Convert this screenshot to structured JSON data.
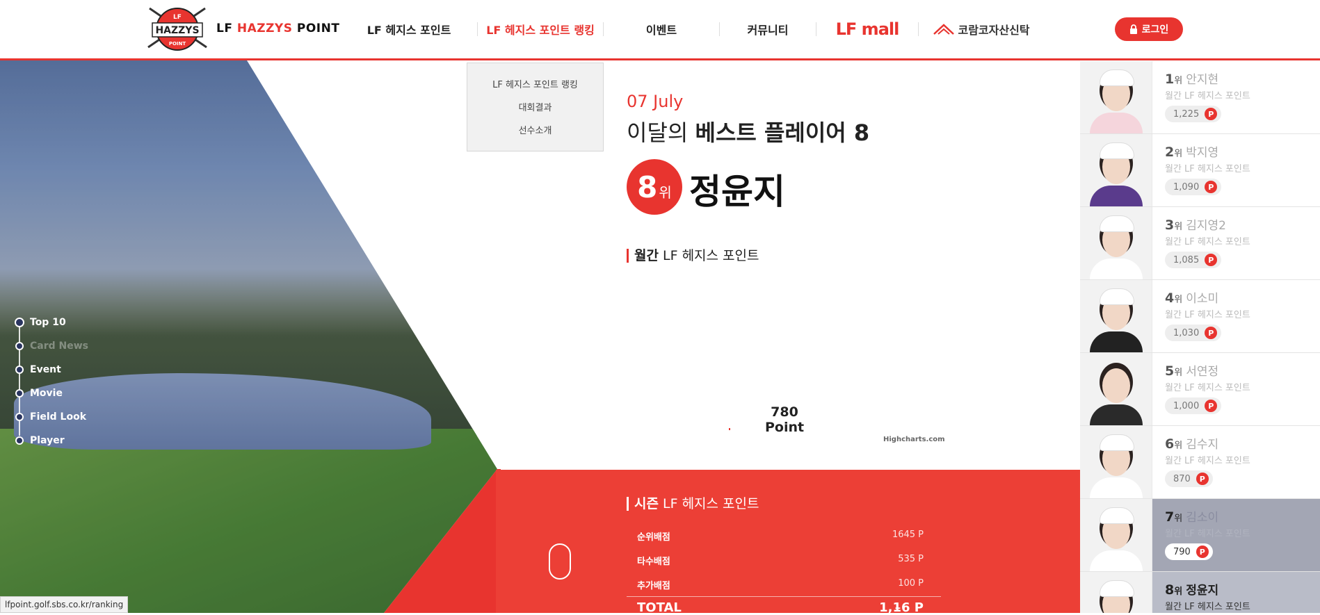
{
  "header": {
    "logo_badge_top": "LF",
    "logo_badge_main": "HAZZYS",
    "logo_badge_bottom": "POINT",
    "logo_prefix": "LF",
    "logo_brand": "HAZZYS",
    "logo_suffix": "POINT",
    "nav": [
      {
        "label": "LF 헤지스 포인트",
        "active": false
      },
      {
        "label": "LF 헤지스 포인트 랭킹",
        "active": true
      },
      {
        "label": "이벤트",
        "active": false
      },
      {
        "label": "커뮤니티",
        "active": false
      }
    ],
    "lfmall": "LF mall",
    "kolon": "코람코자산신탁",
    "login": "로그인"
  },
  "dropdown": [
    "LF 헤지스 포인트 랭킹",
    "대회결과",
    "선수소개"
  ],
  "side_nav": [
    {
      "label": "Top 10",
      "active": true
    },
    {
      "label": "Card News",
      "faded": true
    },
    {
      "label": "Event"
    },
    {
      "label": "Movie"
    },
    {
      "label": "Field Look"
    },
    {
      "label": "Player"
    }
  ],
  "feature": {
    "date": "07 July",
    "headline_prefix": "이달의",
    "headline_bold": "베스트 플레이어 8",
    "rank_number": "8",
    "rank_unit": "위",
    "player": "정윤지",
    "monthly_title_bold": "월간",
    "monthly_title_rest": "LF 헤지스 포인트",
    "chart_value": "780",
    "chart_unit": "Point",
    "credit": "Highcharts.com"
  },
  "season": {
    "title_bold": "시즌",
    "title_rest": "LF 헤지스 포인트",
    "rows": [
      {
        "label": "순위배점",
        "value": "1645 P"
      },
      {
        "label": "타수배점",
        "value": "535 P"
      },
      {
        "label": "추가배점",
        "value": "100 P"
      }
    ],
    "total_label": "TOTAL",
    "total_value": "1,1̵6 P"
  },
  "ranking": [
    {
      "rank": "1",
      "unit": "위",
      "name": "안지현",
      "sub": "월간 LF 헤지스 포인트",
      "points": "1,225"
    },
    {
      "rank": "2",
      "unit": "위",
      "name": "박지영",
      "sub": "월간 LF 헤지스 포인트",
      "points": "1,090"
    },
    {
      "rank": "3",
      "unit": "위",
      "name": "김지영2",
      "sub": "월간 LF 헤지스 포인트",
      "points": "1,085"
    },
    {
      "rank": "4",
      "unit": "위",
      "name": "이소미",
      "sub": "월간 LF 헤지스 포인트",
      "points": "1,030"
    },
    {
      "rank": "5",
      "unit": "위",
      "name": "서연정",
      "sub": "월간 LF 헤지스 포인트",
      "points": "1,000"
    },
    {
      "rank": "6",
      "unit": "위",
      "name": "김수지",
      "sub": "월간 LF 헤지스 포인트",
      "points": "870"
    },
    {
      "rank": "7",
      "unit": "위",
      "name": "김소이",
      "sub": "월간 LF 헤지스 포인트",
      "points": "790"
    },
    {
      "rank": "8",
      "unit": "위",
      "name": "정윤지",
      "sub": "월간 LF 헤지스 포인트",
      "points": ""
    }
  ],
  "p_icon": "P",
  "status_url": "lfpoint.golf.sbs.co.kr/ranking"
}
